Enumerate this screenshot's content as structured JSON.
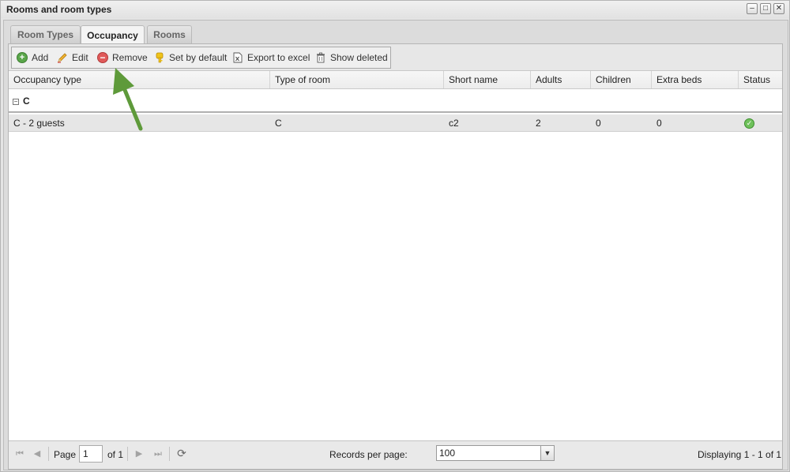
{
  "window": {
    "title": "Rooms and room types",
    "min_glyph": "–",
    "max_glyph": "□",
    "close_glyph": "✕"
  },
  "tabs": [
    {
      "label": "Room Types",
      "active": false
    },
    {
      "label": "Occupancy",
      "active": true
    },
    {
      "label": "Rooms",
      "active": false
    }
  ],
  "toolbar": {
    "add": "Add",
    "edit": "Edit",
    "remove": "Remove",
    "set_default": "Set by default",
    "export": "Export to excel",
    "show_deleted": "Show deleted",
    "icons": {
      "add": "add-icon",
      "edit": "pencil-icon",
      "remove": "remove-icon",
      "set_default": "key-icon",
      "export": "excel-icon",
      "show_deleted": "trash-icon"
    }
  },
  "columns": [
    "Occupancy type",
    "Type of room",
    "Short name",
    "Adults",
    "Children",
    "Extra beds",
    "Status"
  ],
  "group": {
    "toggle": "−",
    "label": "C"
  },
  "rows": [
    {
      "occupancy_type": "C - 2 guests",
      "type_of_room": "C",
      "short_name": "c2",
      "adults": "2",
      "children": "0",
      "extra_beds": "0",
      "status": "active",
      "status_glyph": "✓"
    }
  ],
  "pager": {
    "page_label": "Page",
    "page_value": "1",
    "of_label": "of 1",
    "records_label": "Records per page:",
    "records_value": "100",
    "select_arrow": "▼",
    "displaying": "Displaying 1 - 1 of 1",
    "glyphs": {
      "first": "⏮",
      "prev": "◀",
      "next": "▶",
      "last": "⏭",
      "refresh": "⟳"
    }
  },
  "annotation": {
    "type": "arrow",
    "color": "#5e9a3a",
    "target": "remove-button"
  }
}
